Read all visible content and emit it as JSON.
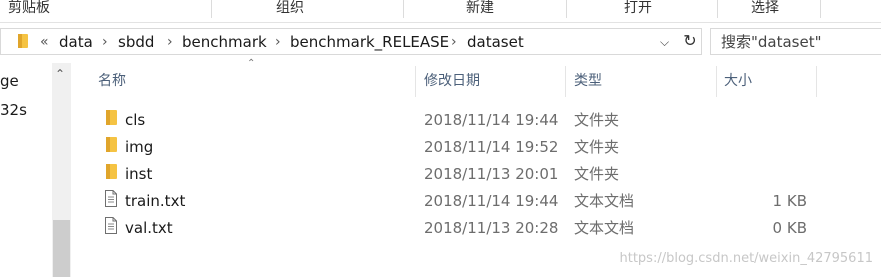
{
  "ribbon": {
    "groups": [
      "剪贴板",
      "组织",
      "新建",
      "打开",
      "选择"
    ]
  },
  "address": {
    "overflow": "«",
    "crumbs": [
      "data",
      "sbdd",
      "benchmark",
      "benchmark_RELEASE",
      "dataset"
    ],
    "separator": "›"
  },
  "search": {
    "text": "搜索\"dataset\""
  },
  "nav": {
    "items": [
      "ge",
      "32s"
    ]
  },
  "columns": {
    "name": "名称",
    "date": "修改日期",
    "type": "类型",
    "size": "大小"
  },
  "files": [
    {
      "name": "cls",
      "date": "2018/11/14 19:44",
      "type": "文件夹",
      "size": "",
      "icon": "folder-icon"
    },
    {
      "name": "img",
      "date": "2018/11/14 19:52",
      "type": "文件夹",
      "size": "",
      "icon": "folder-icon"
    },
    {
      "name": "inst",
      "date": "2018/11/13 20:01",
      "type": "文件夹",
      "size": "",
      "icon": "folder-icon"
    },
    {
      "name": "train.txt",
      "date": "2018/11/14 19:44",
      "type": "文本文档",
      "size": "1 KB",
      "icon": "text-file-icon"
    },
    {
      "name": "val.txt",
      "date": "2018/11/13 20:28",
      "type": "文本文档",
      "size": "0 KB",
      "icon": "text-file-icon"
    }
  ],
  "watermark": "https://blog.csdn.net/weixin_42795611",
  "colors": {
    "folder": "#f5c343",
    "folder_dark": "#e0a52b",
    "header_text": "#4c607a",
    "muted_text": "#6d6d6d"
  }
}
